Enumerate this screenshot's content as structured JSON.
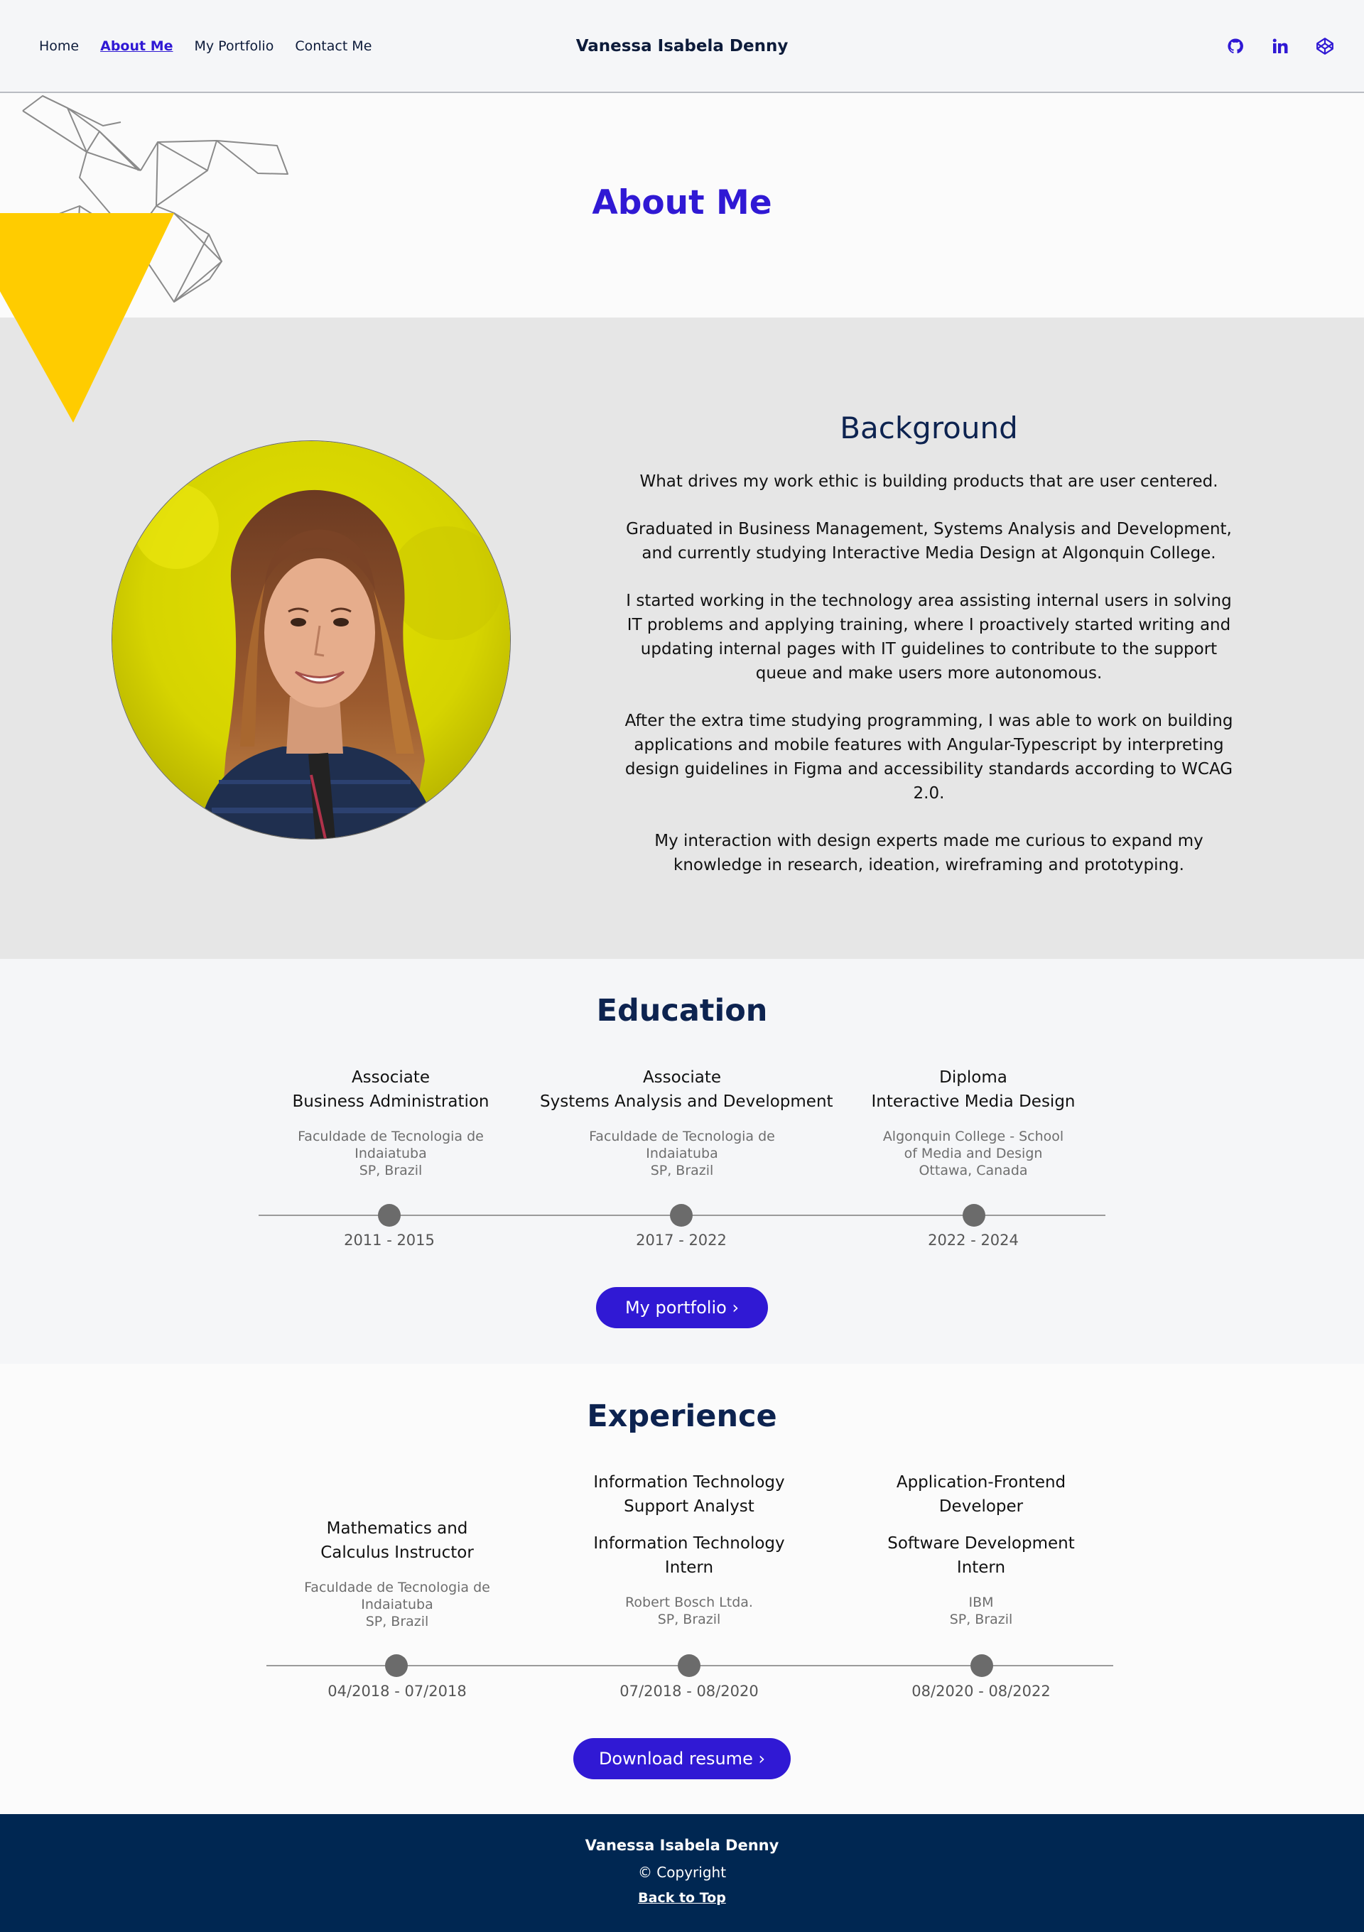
{
  "header": {
    "nav": [
      "Home",
      "About Me",
      "My Portfolio",
      "Contact Me"
    ],
    "active_nav": "About Me",
    "brand": "Vanessa Isabela Denny",
    "social_icons": [
      "github-icon",
      "linkedin-icon",
      "codepen-icon"
    ]
  },
  "colors": {
    "accent": "#3019d4",
    "navy": "#002752",
    "yellow": "#ffcc00",
    "section_gray": "#e6e6e6"
  },
  "about": {
    "title": "About Me"
  },
  "background": {
    "title": "Background",
    "paragraphs": [
      "What drives my work ethic is building products that are user centered.",
      "Graduated in Business Management, Systems Analysis and Development, and currently studying Interactive Media Design at Algonquin College.",
      "I started working in the technology area assisting internal users in solving IT problems and applying training, where I proactively started writing and updating internal pages with IT guidelines to contribute to the support queue and make users more autonomous.",
      "After the extra time studying programming, I was able to work on building applications and mobile features with Angular-Typescript by interpreting design guidelines in Figma and accessibility standards according to WCAG 2.0.",
      "My interaction with design experts made me curious to expand my knowledge in research, ideation, wireframing and prototyping."
    ]
  },
  "education": {
    "title": "Education",
    "items": [
      {
        "degree1": "Associate",
        "degree2": "Business Administration",
        "inst1": "Faculdade de Tecnologia de",
        "inst2": "Indaiatuba",
        "inst3": "SP, Brazil",
        "date": "2011 - 2015"
      },
      {
        "degree1": "Associate",
        "degree2": "Systems Analysis and Development",
        "inst1": "Faculdade de Tecnologia de",
        "inst2": "Indaiatuba",
        "inst3": "SP, Brazil",
        "date": "2017 - 2022"
      },
      {
        "degree1": "Diploma",
        "degree2": "Interactive Media Design",
        "inst1": "Algonquin College - School",
        "inst2": "of Media and Design",
        "inst3": "Ottawa, Canada",
        "date": "2022 - 2024"
      }
    ],
    "button": "My portfolio ›"
  },
  "experience": {
    "title": "Experience",
    "items": [
      {
        "role1a": "Mathematics and",
        "role1b": "Calculus Instructor",
        "inst1": "Faculdade de Tecnologia de",
        "inst2": "Indaiatuba",
        "inst3": "SP, Brazil",
        "date": "04/2018 - 07/2018"
      },
      {
        "role1a": "Information Technology",
        "role1b": "Support Analyst",
        "role2a": "Information Technology",
        "role2b": "Intern",
        "inst1": "Robert Bosch Ltda.",
        "inst2": "SP, Brazil",
        "date": "07/2018 - 08/2020"
      },
      {
        "role1a": "Application-Frontend",
        "role1b": "Developer",
        "role2a": "Software Development",
        "role2b": "Intern",
        "inst1": "IBM",
        "inst2": "SP, Brazil",
        "date": "08/2020 - 08/2022"
      }
    ],
    "button": "Download resume ›"
  },
  "footer": {
    "name": "Vanessa Isabela Denny",
    "copyright": "©  Copyright",
    "back_to_top": "Back to Top"
  }
}
